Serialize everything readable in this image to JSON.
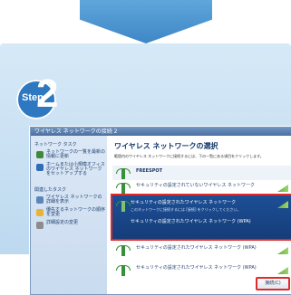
{
  "step": {
    "label": "Step",
    "number": "2"
  },
  "window": {
    "title": "ワイヤレス ネットワークの接続 2",
    "heading": "ワイヤレス ネットワークの選択",
    "description": "範囲内のワイヤレス ネットワークに接続するには、下の一覧にある項目をクリックします。",
    "connect_button": "接続(C)"
  },
  "sidebar": {
    "heading_tasks": "ネットワーク タスク",
    "heading_related": "関連したタスク",
    "items": [
      {
        "label": "ネットワークの一覧を最新の情報に更新"
      },
      {
        "label": "ホームまたは小規模オフィスのワイヤレス ネットワークをセットアップする"
      },
      {
        "label": "ワイヤレス ネットワークの詳細を表示"
      },
      {
        "label": "優先するネットワークの順序を変更"
      },
      {
        "label": "詳細設定の変更"
      }
    ]
  },
  "networks": [
    {
      "name": "FREESPOT",
      "sub": ""
    },
    {
      "name": "セキュリティの設定されていないワイヤレス ネットワーク",
      "sub": ""
    },
    {
      "name": "セキュリティの設定されたワイヤレス ネットワーク (WPA)",
      "sub": ""
    },
    {
      "name": "セキュリティの設定されたワイヤレス ネットワーク (WPA)",
      "sub": ""
    }
  ],
  "selected_network": {
    "name": "セキュリティの設定されたワイヤレス ネットワーク",
    "detail": "このネットワークに接続するには [接続] をクリックしてください。",
    "lock_text": "セキュリティの設定されたワイヤレス ネットワーク (WPA)"
  },
  "colors": {
    "accent_blue": "#2d78c0",
    "highlight_red": "#e22a2a",
    "selected_bg": "#1d4f95"
  }
}
